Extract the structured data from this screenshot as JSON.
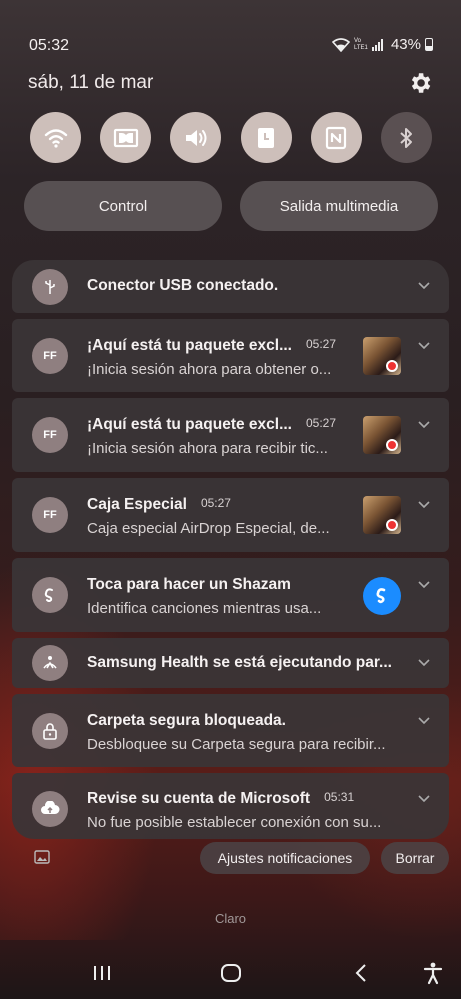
{
  "status": {
    "time": "05:32",
    "network": "Vo LTE1",
    "battery": "43%"
  },
  "header": {
    "date": "sáb, 11 de mar"
  },
  "quick_settings": [
    {
      "name": "wifi-icon",
      "state": "on"
    },
    {
      "name": "dolby-icon",
      "state": "on"
    },
    {
      "name": "sound-icon",
      "state": "on"
    },
    {
      "name": "clock-icon",
      "state": "on"
    },
    {
      "name": "nfc-icon",
      "state": "on"
    },
    {
      "name": "bluetooth-icon",
      "state": "off"
    }
  ],
  "controls": {
    "control_label": "Control",
    "media_label": "Salida multimedia"
  },
  "notifications": [
    {
      "icon": "usb-icon",
      "title": "Conector USB conectado.",
      "time": "",
      "text": ""
    },
    {
      "icon": "ff",
      "icon_text": "FF",
      "title": "¡Aquí está tu paquete excl...",
      "time": "05:27",
      "text": "¡Inicia sesión ahora para obtener o..."
    },
    {
      "icon": "ff",
      "icon_text": "FF",
      "title": "¡Aquí está tu paquete excl...",
      "time": "05:27",
      "text": "¡Inicia sesión ahora para recibir tic..."
    },
    {
      "icon": "ff",
      "icon_text": "FF",
      "title": "Caja Especial",
      "time": "05:27",
      "text": "Caja especial AirDrop Especial, de..."
    },
    {
      "icon": "shazam-icon",
      "title": "Toca para hacer un Shazam",
      "time": "",
      "text": "Identifica canciones mientras usa..."
    },
    {
      "icon": "health-icon",
      "title": "Samsung Health se está ejecutando par...",
      "time": "",
      "text": ""
    },
    {
      "icon": "lock-icon",
      "title": "Carpeta segura bloqueada.",
      "time": "",
      "text": "Desbloquee su Carpeta segura para recibir..."
    },
    {
      "icon": "cloud-icon",
      "title": "Revise su cuenta de Microsoft",
      "time": "05:31",
      "text": "No fue posible establecer conexión con su..."
    }
  ],
  "actions": {
    "notif_settings": "Ajustes notificaciones",
    "clear": "Borrar"
  },
  "carrier": "Claro",
  "colors": {
    "tile_on": "#cdbfba",
    "tile_off": "#5a5052",
    "card": "#3a3537",
    "shazam": "#1b8cff"
  }
}
